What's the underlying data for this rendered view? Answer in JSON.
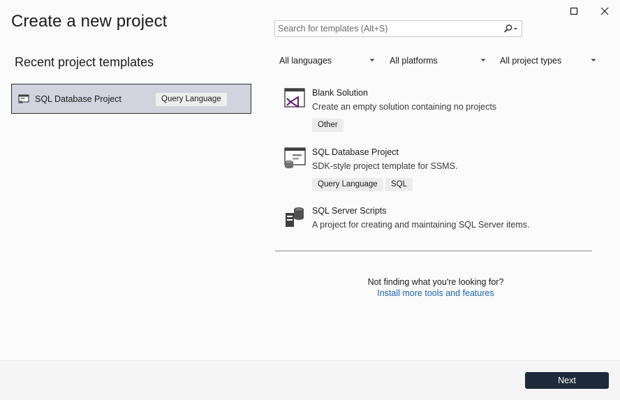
{
  "page_title": "Create a new project",
  "search": {
    "placeholder": "Search for templates (Alt+S)"
  },
  "recent": {
    "heading": "Recent project templates",
    "items": [
      {
        "name": "SQL Database Project",
        "tag": "Query Language",
        "icon": "sql-database-project-icon"
      }
    ]
  },
  "filters": {
    "language": "All languages",
    "platform": "All platforms",
    "project_type": "All project types"
  },
  "templates": [
    {
      "name": "Blank Solution",
      "description": "Create an empty solution containing no projects",
      "tags": [
        "Other"
      ],
      "icon": "blank-solution-icon"
    },
    {
      "name": "SQL Database Project",
      "description": "SDK-style project template for SSMS.",
      "tags": [
        "Query Language",
        "SQL"
      ],
      "icon": "sql-database-project-icon"
    },
    {
      "name": "SQL Server Scripts",
      "description": "A project for creating and maintaining SQL Server items.",
      "tags": [],
      "icon": "sql-server-scripts-icon"
    }
  ],
  "help": {
    "not_finding": "Not finding what you're looking for?",
    "install_link": "Install more tools and features"
  },
  "footer": {
    "next_label": "Next"
  },
  "colors": {
    "accent_button": "#1f2a3a",
    "selected_item": "#d1d3de",
    "link": "#1a63b3",
    "vs_purple": "#68217a"
  }
}
